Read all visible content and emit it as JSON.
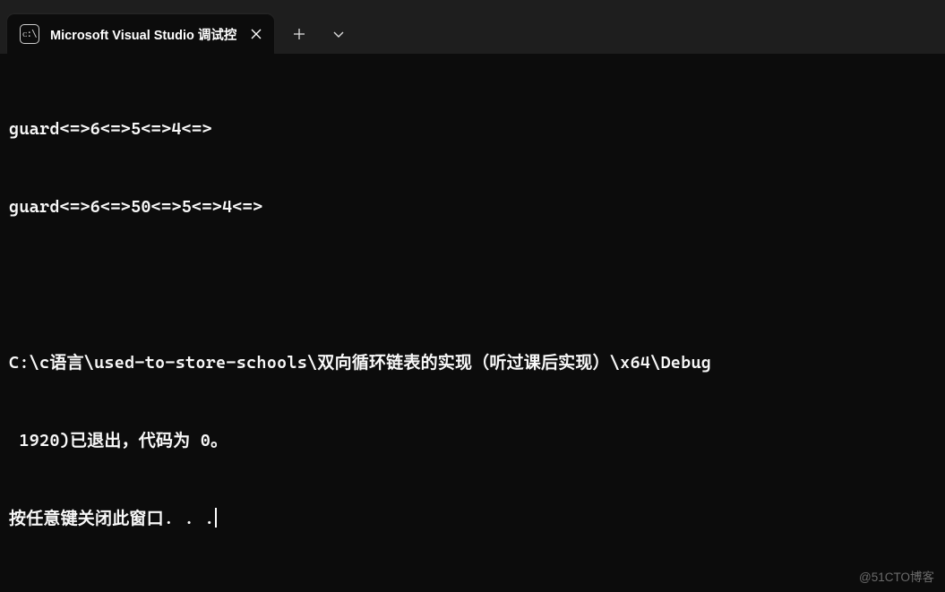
{
  "tab": {
    "icon_text": "ᴄ:\\",
    "title": "Microsoft Visual Studio 调试控"
  },
  "terminal": {
    "lines": [
      "guard<=>6<=>5<=>4<=>",
      "guard<=>6<=>50<=>5<=>4<=>",
      "",
      "C:\\c语言\\used-to-store-schools\\双向循环链表的实现（听过课后实现）\\x64\\Debug",
      " 1920)已退出，代码为 0。",
      "按任意键关闭此窗口. . ."
    ]
  },
  "watermark": "@51CTO博客"
}
